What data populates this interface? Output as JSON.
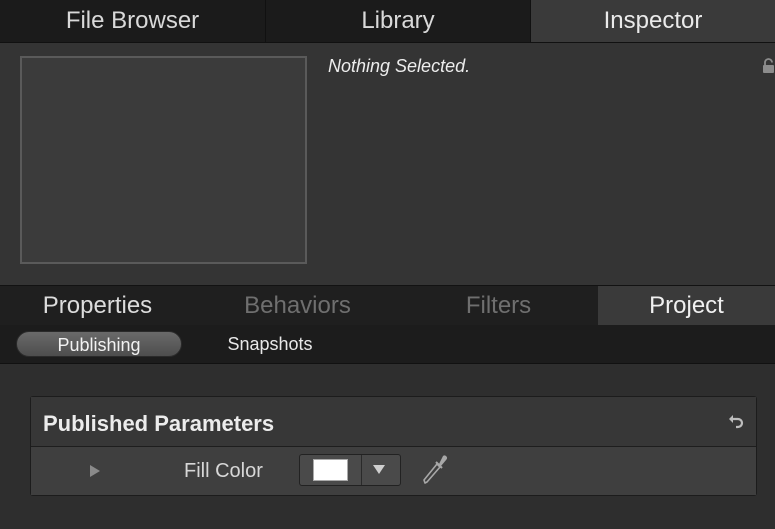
{
  "top_tabs": [
    {
      "label": "File Browser"
    },
    {
      "label": "Library"
    },
    {
      "label": "Inspector",
      "active": true
    }
  ],
  "preview": {
    "status_text": "Nothing Selected.",
    "lock_icon": "lock-icon"
  },
  "inspector_tabs": [
    {
      "label": "Properties",
      "enabled": true
    },
    {
      "label": "Behaviors",
      "enabled": false
    },
    {
      "label": "Filters",
      "enabled": false
    },
    {
      "label": "Project",
      "enabled": true,
      "active": true
    }
  ],
  "segments": [
    {
      "label": "Publishing",
      "active": true
    },
    {
      "label": "Snapshots",
      "active": false
    }
  ],
  "published_parameters": {
    "title": "Published Parameters",
    "reset_icon": "reset-icon",
    "rows": [
      {
        "label": "Fill Color",
        "color_value": "#ffffff",
        "disclosure_icon": "disclosure-triangle-icon",
        "dropdown_icon": "chevron-down-icon",
        "eyedropper_icon": "eyedropper-icon"
      }
    ]
  },
  "colors": {
    "background": "#2b2b2b",
    "tab_bar": "#1b1b1b",
    "active_tab": "#3a3a3a",
    "text": "#e6e6e6",
    "disabled_text": "#6f6f6f"
  }
}
